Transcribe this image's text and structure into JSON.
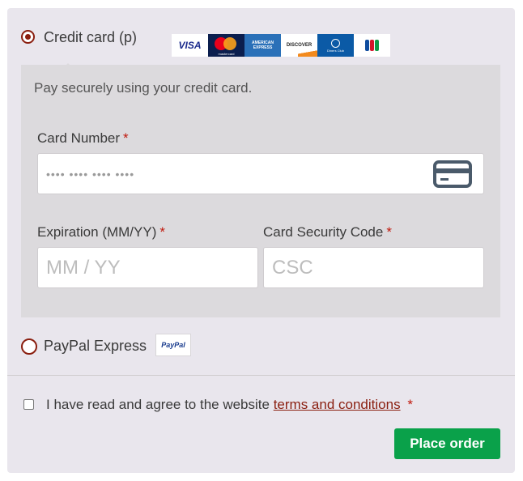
{
  "payment": {
    "credit_card": {
      "label": "Credit card (p)",
      "selected": true,
      "brands": [
        "VISA",
        "mastercard",
        "AMERICAN EXPRESS",
        "DISCOVER",
        "Diners Club",
        "JCB"
      ],
      "description": "Pay securely using your credit card.",
      "card_number": {
        "label": "Card Number",
        "required": "*",
        "placeholder": "•••• •••• •••• ••••",
        "value": ""
      },
      "expiration": {
        "label": "Expiration (MM/YY)",
        "required": "*",
        "placeholder": "MM / YY",
        "value": ""
      },
      "csc": {
        "label": "Card Security Code",
        "required": "*",
        "placeholder": "CSC",
        "value": ""
      }
    },
    "paypal": {
      "label": "PayPal Express",
      "selected": false,
      "logo_text": "PayPal"
    }
  },
  "terms": {
    "text": "I have read and agree to the website",
    "link_text": "terms and conditions",
    "required": "*",
    "checked": false
  },
  "place_order_label": "Place order",
  "colors": {
    "accent": "#8a1e0f",
    "button": "#0aa14a",
    "panel_bg": "#e9e6ed",
    "box_bg": "#dcdadd"
  }
}
